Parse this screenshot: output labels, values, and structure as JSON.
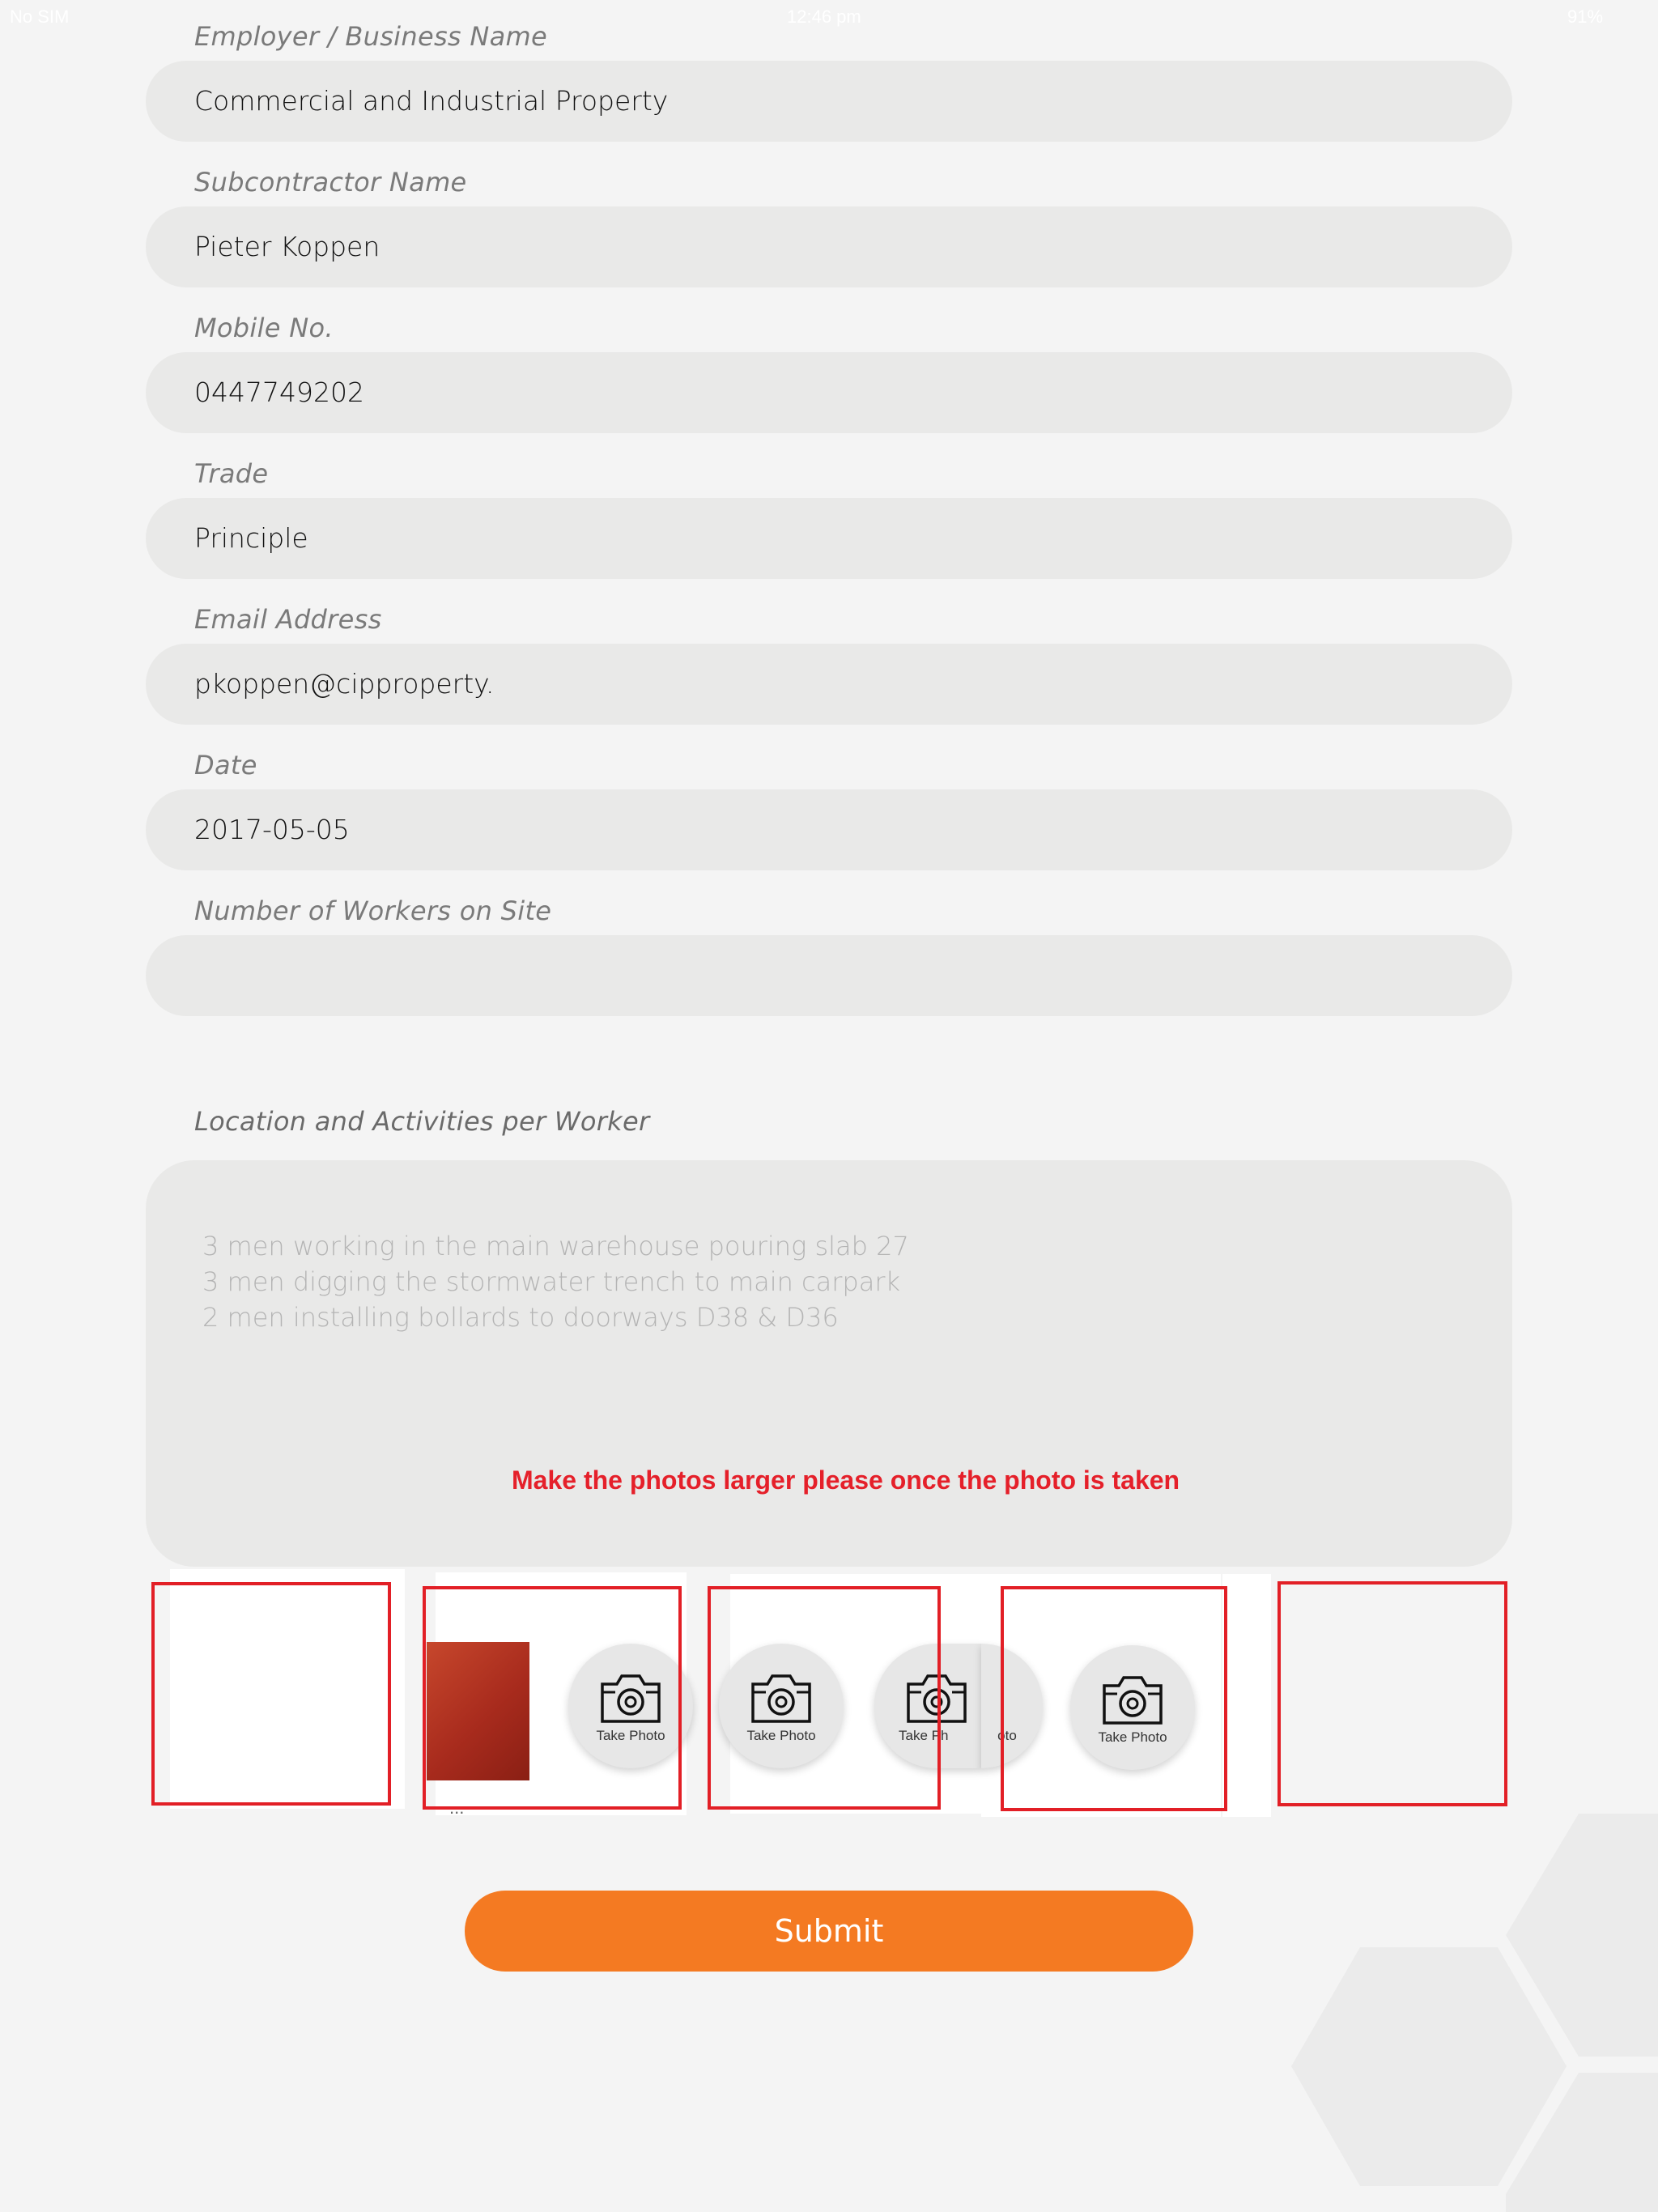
{
  "status_bar": {
    "carrier": "No SIM",
    "time": "12:46 pm",
    "battery": "91%"
  },
  "form": {
    "employer_label": "Employer / Business Name",
    "employer_value": "Commercial and Industrial Property",
    "subcontractor_label": "Subcontractor Name",
    "subcontractor_value": "Pieter Koppen",
    "mobile_label": "Mobile No.",
    "mobile_value": "0447749202",
    "trade_label": "Trade",
    "trade_value": "Principle",
    "email_label": "Email Address",
    "email_value": "pkoppen@cipproperty.",
    "date_label": "Date",
    "date_value": "2017-05-05",
    "workers_label": "Number of Workers on Site",
    "workers_value": "",
    "activities_label": "Location and Activities per Worker",
    "activities_lines": [
      "3 men working in the main warehouse pouring slab 27",
      "3 men digging the stormwater trench to main carpark",
      "2 men installing bollards to doorways D38 & D36"
    ]
  },
  "annotation": "Make the photos larger please once the photo is taken",
  "photos": {
    "take_photo_label": "Take Photo",
    "partial_label_a": "Take Ph",
    "partial_label_b": "oto",
    "under_text": "..."
  },
  "submit_label": "Submit",
  "colors": {
    "accent": "#f47a22",
    "annotation": "#e21f26",
    "field_bg": "#e9e9e8"
  }
}
